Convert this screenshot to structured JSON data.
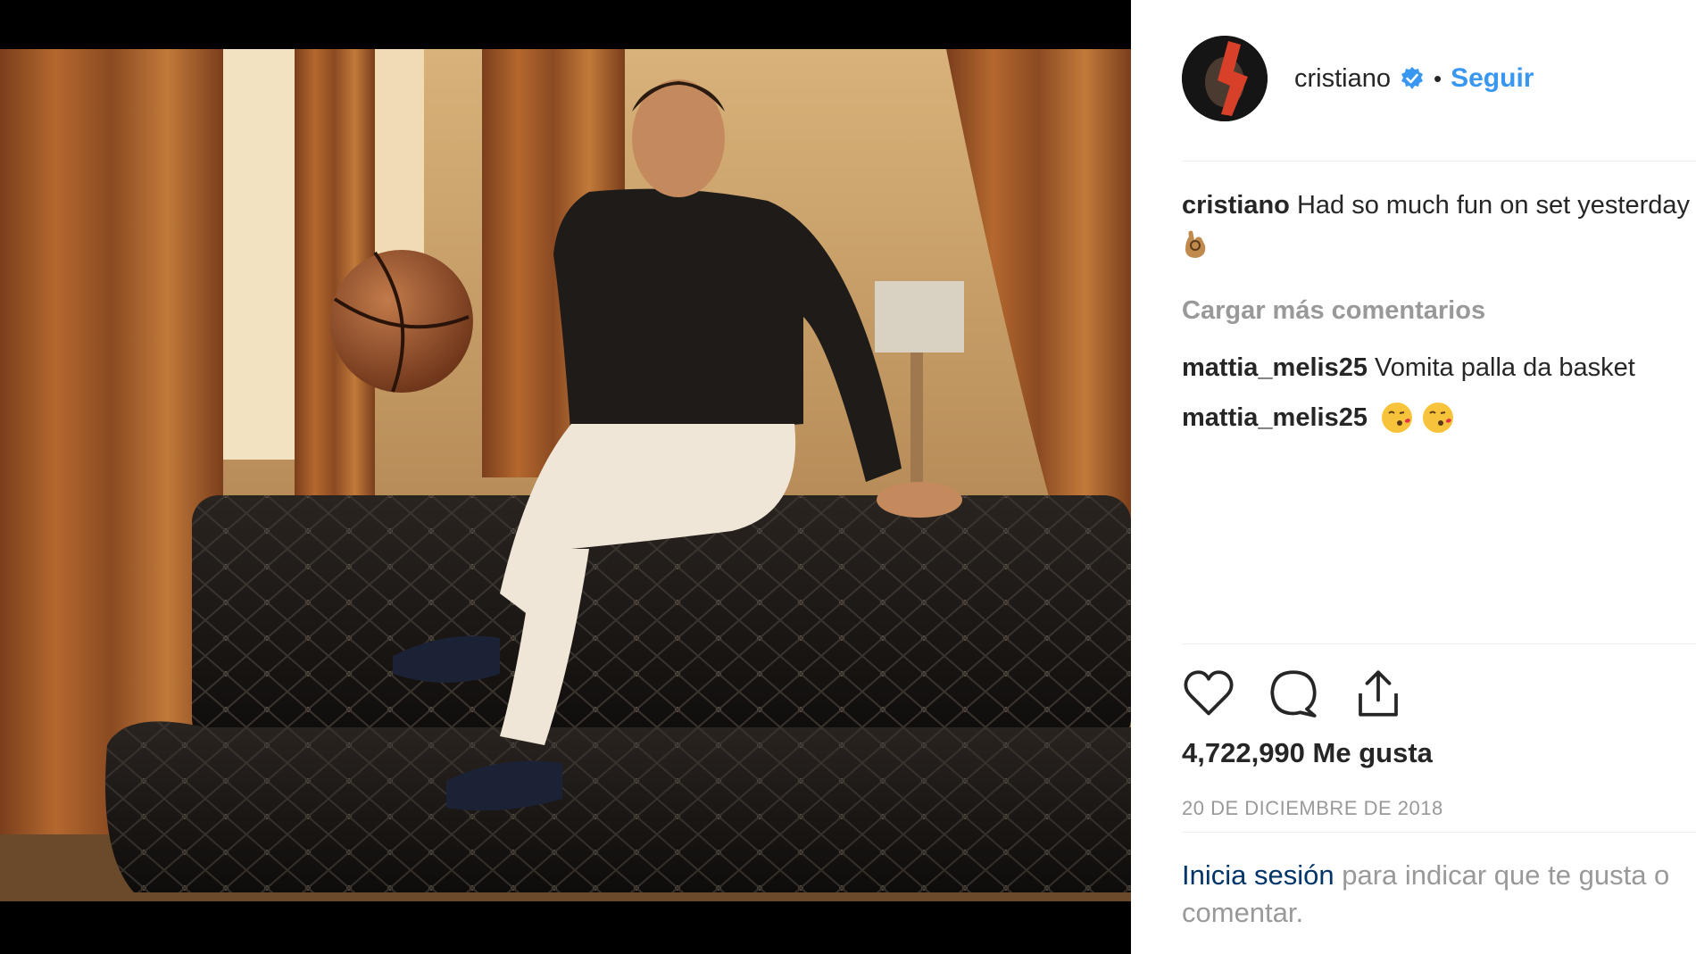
{
  "post": {
    "username": "cristiano",
    "follow_label": "Seguir",
    "separator": "•",
    "caption": {
      "username": "cristiano",
      "text": "Had so much fun on set yesterday",
      "emoji": "ok-hand-emoji"
    },
    "load_more_label": "Cargar más comentarios",
    "comments": [
      {
        "username": "mattia_melis25",
        "text": "Vomita palla da basket"
      },
      {
        "username": "mattia_melis25",
        "text": "",
        "emoji": [
          "kiss-face-emoji",
          "kiss-face-emoji"
        ]
      }
    ],
    "likes_text": "4,722,990 Me gusta",
    "date_text": "20 DE DICIEMBRE DE 2018",
    "login_prompt": {
      "link_label": "Inicia sesión",
      "rest_text": "para indicar que te gusta o comentar."
    }
  },
  "icons": {
    "verified": "verified-badge-icon",
    "like": "heart-icon",
    "comment": "comment-bubble-icon",
    "share": "share-icon"
  },
  "colors": {
    "accent": "#3897f0",
    "verified": "#3897f0",
    "muted": "#999999",
    "text": "#262626",
    "link_dark": "#003569"
  }
}
